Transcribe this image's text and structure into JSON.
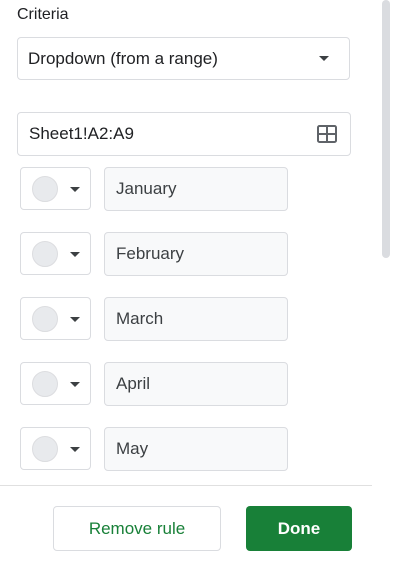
{
  "criteria": {
    "label": "Criteria",
    "selected": "Dropdown (from a range)"
  },
  "range": {
    "value": "Sheet1!A2:A9",
    "icon": "grid-select-icon"
  },
  "items": [
    {
      "label": "January",
      "color": "#e8eaed"
    },
    {
      "label": "February",
      "color": "#e8eaed"
    },
    {
      "label": "March",
      "color": "#e8eaed"
    },
    {
      "label": "April",
      "color": "#e8eaed"
    },
    {
      "label": "May",
      "color": "#e8eaed"
    }
  ],
  "footer": {
    "remove_label": "Remove rule",
    "done_label": "Done"
  },
  "colors": {
    "accent": "#188038",
    "border": "#dadce0",
    "input_bg": "#f8f9fa"
  }
}
